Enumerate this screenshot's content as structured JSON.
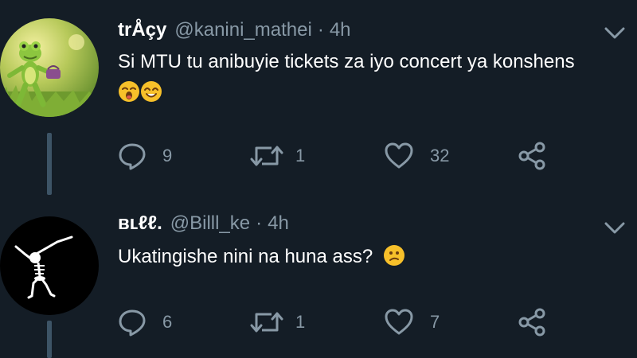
{
  "tweets": [
    {
      "display_name": "trÅçy",
      "handle": "@kanini_mathei",
      "separator": "·",
      "time": "4h",
      "text": "Si MTU tu anibuyie tickets za iyo concert ya konshens",
      "emojis": [
        "sleepy-face-emoji",
        "smiling-face-emoji"
      ],
      "reply_count": "9",
      "retweet_count": "1",
      "like_count": "32",
      "avatar": "green-frog-figurine"
    },
    {
      "display_name": "ʙʟℓℓ.",
      "handle": "@Billl_ke",
      "separator": "·",
      "time": "4h",
      "text": "Ukatingishe nini na huna ass?",
      "emojis": [
        "confused-face-emoji"
      ],
      "reply_count": "6",
      "retweet_count": "1",
      "like_count": "7",
      "avatar": "dabbing-skeleton"
    }
  ],
  "colors": {
    "background": "#141d26",
    "secondary_text": "#8899a6",
    "thread_line": "#3d5466",
    "emoji_yellow": "#f7c02a"
  }
}
